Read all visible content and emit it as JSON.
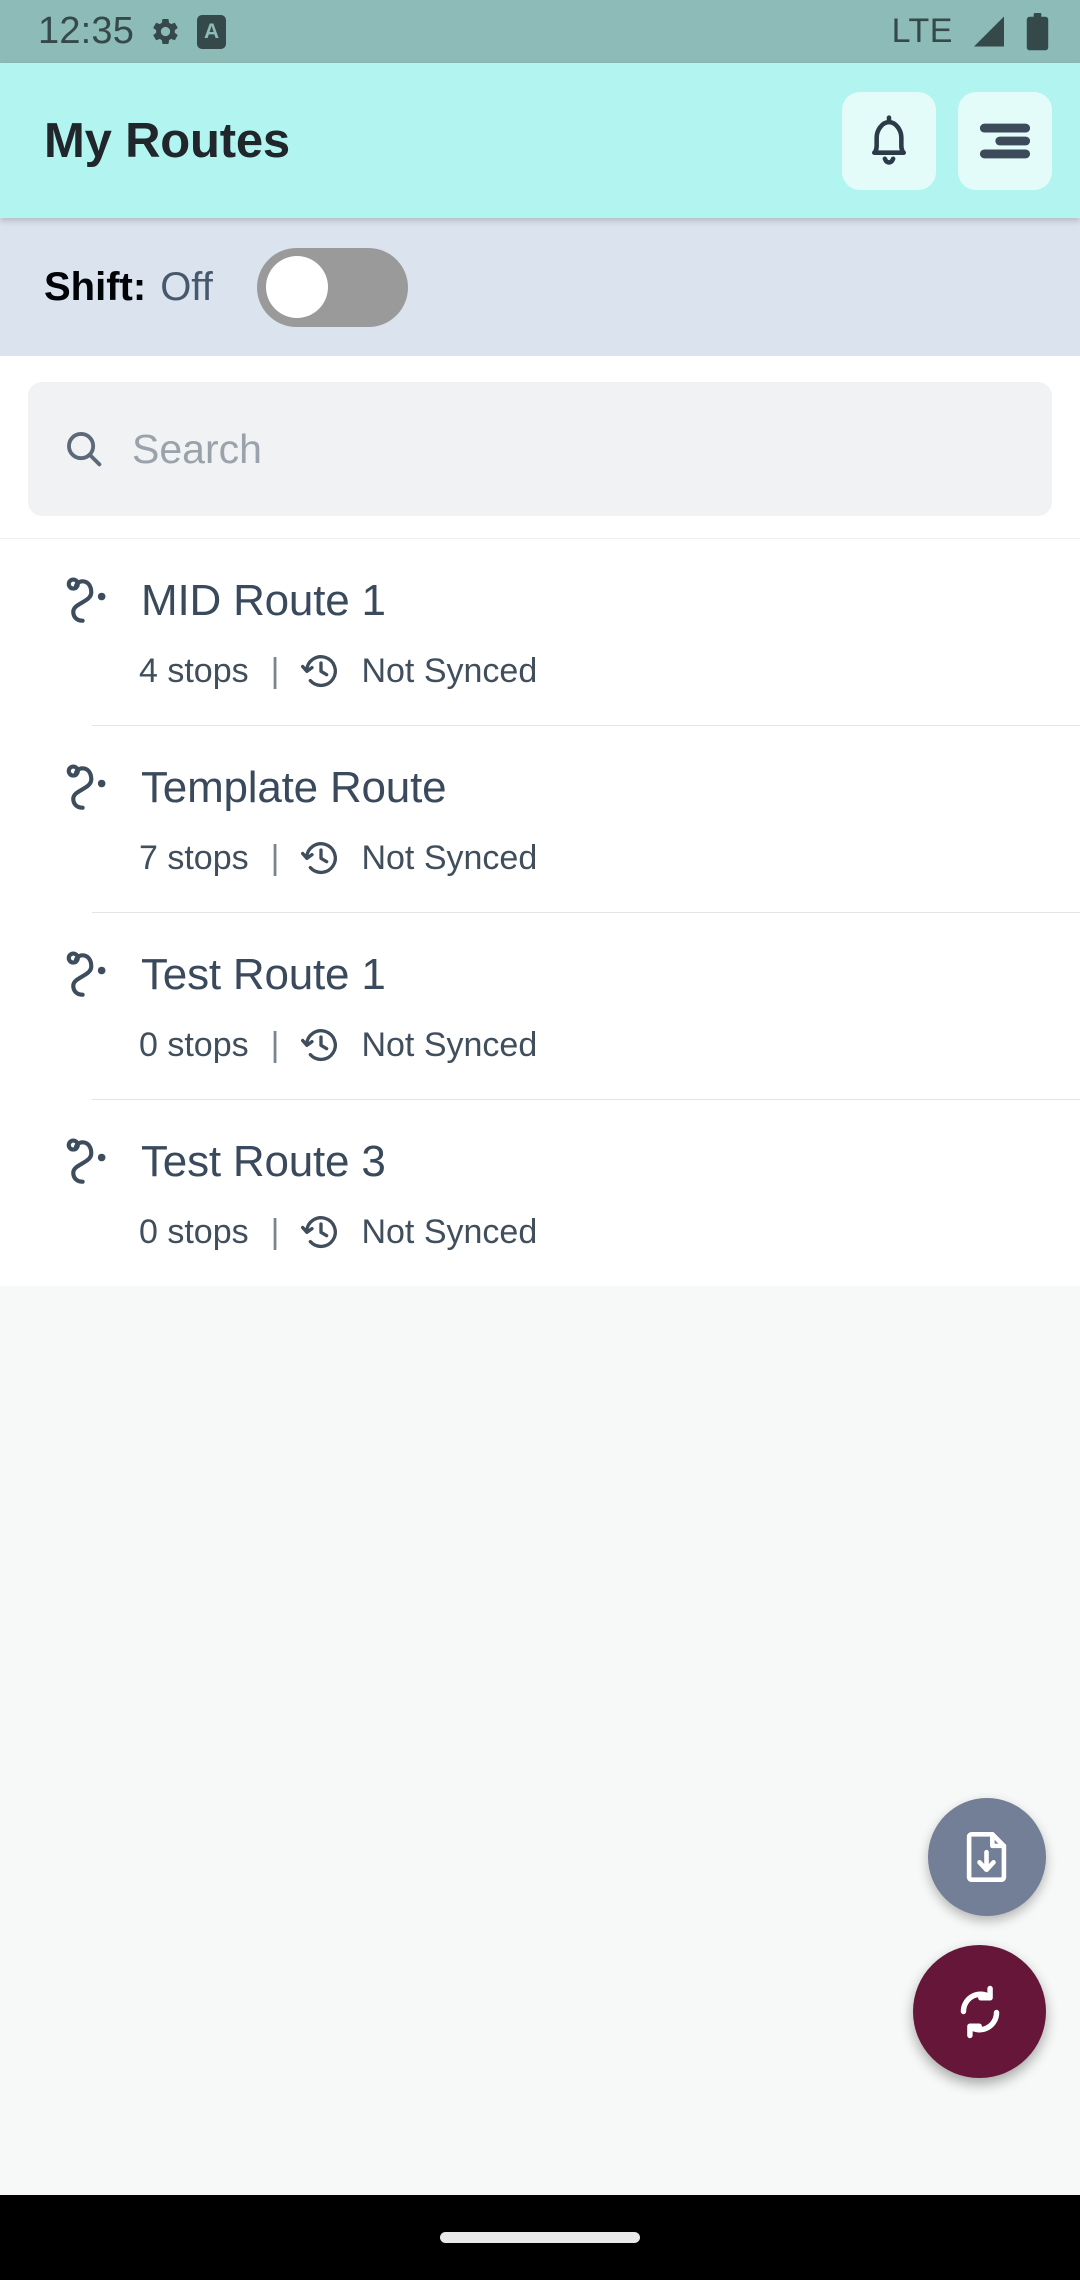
{
  "statusbar": {
    "time": "12:35",
    "gear_icon": "gear-icon",
    "app_badge": "A",
    "network": "LTE",
    "signal_icon": "signal-icon",
    "battery_icon": "battery-icon"
  },
  "appbar": {
    "title": "My Routes",
    "notifications_icon": "bell-icon",
    "menu_icon": "menu-icon",
    "bg_color": "#b2f5f0"
  },
  "shift": {
    "label": "Shift:",
    "value": "Off",
    "toggle_on": false
  },
  "search": {
    "value": "",
    "placeholder": "Search",
    "icon": "search-icon"
  },
  "routes": [
    {
      "name": "MID Route 1",
      "stops": "4 stops",
      "separator": "|",
      "sync_status": "Not Synced",
      "route_icon": "route-path-icon",
      "sync_icon": "history-clock-icon"
    },
    {
      "name": "Template Route",
      "stops": "7 stops",
      "separator": "|",
      "sync_status": "Not Synced",
      "route_icon": "route-path-icon",
      "sync_icon": "history-clock-icon"
    },
    {
      "name": "Test Route 1",
      "stops": "0 stops",
      "separator": "|",
      "sync_status": "Not Synced",
      "route_icon": "route-path-icon",
      "sync_icon": "history-clock-icon"
    },
    {
      "name": "Test Route 3",
      "stops": "0 stops",
      "separator": "|",
      "sync_status": "Not Synced",
      "route_icon": "route-path-icon",
      "sync_icon": "history-clock-icon"
    }
  ],
  "fabs": {
    "import": {
      "icon": "file-download-icon",
      "color": "#737e97"
    },
    "sync": {
      "icon": "sync-refresh-icon",
      "color": "#661639"
    }
  },
  "navbar": {
    "gesture_pill": "gesture-pill"
  }
}
